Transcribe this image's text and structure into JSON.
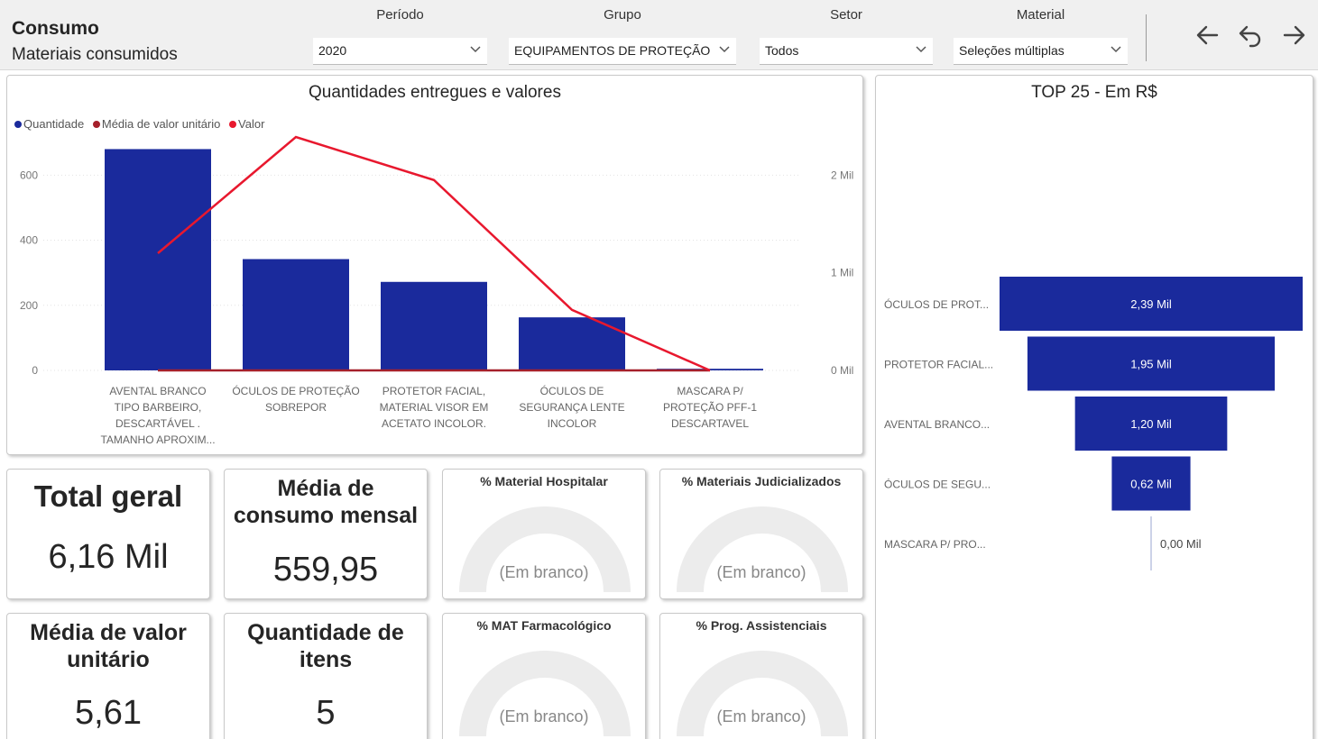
{
  "header": {
    "title": "Consumo",
    "subtitle": "Materiais consumidos"
  },
  "filters": [
    {
      "label": "Período",
      "value": "2020"
    },
    {
      "label": "Grupo",
      "value": "EQUIPAMENTOS DE PROTEÇÃO"
    },
    {
      "label": "Setor",
      "value": "Todos"
    },
    {
      "label": "Material",
      "value": "Seleções múltiplas"
    }
  ],
  "nav": {
    "back_icon": "arrow-left-icon",
    "undo_icon": "undo-icon",
    "forward_icon": "arrow-right-icon"
  },
  "colors": {
    "bar": "#1a2a9c",
    "valor_line": "#e8182e",
    "media_line": "#a5202b",
    "gauge": "#ececec"
  },
  "chart_data": [
    {
      "type": "bar",
      "title": "Quantidades entregues e valores",
      "legend": [
        "Quantidade",
        "Média de valor unitário",
        "Valor"
      ],
      "categories": [
        [
          "AVENTAL BRANCO",
          "TIPO BARBEIRO,",
          "DESCARTÁVEL .",
          "TAMANHO APROXIM..."
        ],
        [
          "ÓCULOS DE PROTEÇÃO",
          "SOBREPOR"
        ],
        [
          "PROTETOR FACIAL,",
          "MATERIAL VISOR EM",
          "ACETATO INCOLOR."
        ],
        [
          "ÓCULOS DE",
          "SEGURANÇA LENTE",
          "INCOLOR"
        ],
        [
          "MASCARA P/",
          "PROTEÇÃO PFF-1",
          "DESCARTAVEL"
        ]
      ],
      "series": [
        {
          "name": "Quantidade",
          "values": [
            680,
            342,
            272,
            163,
            5
          ]
        },
        {
          "name": "Média de valor unitário",
          "values": [
            0,
            0,
            0,
            0,
            0
          ]
        },
        {
          "name": "Valor",
          "values": [
            1200,
            2390,
            1950,
            620,
            0
          ]
        }
      ],
      "y_left": {
        "ylim": [
          0,
          720
        ],
        "ticks": [
          0,
          200,
          400,
          600
        ]
      },
      "y_right": {
        "ylim": [
          0,
          2400
        ],
        "ticks": [
          0,
          1000,
          2000
        ],
        "tick_labels": [
          "0 Mil",
          "1 Mil",
          "2 Mil"
        ]
      },
      "legend_position": "top-left",
      "grid": true
    },
    {
      "type": "bar",
      "title": "TOP 25 - Em R$",
      "orientation": "horizontal-funnel",
      "categories": [
        "ÓCULOS DE PROT...",
        "PROTETOR FACIAL...",
        "AVENTAL BRANCO...",
        "ÓCULOS DE SEGU...",
        "MASCARA P/ PRO..."
      ],
      "values": [
        2.39,
        1.95,
        1.2,
        0.62,
        0.0
      ],
      "value_labels": [
        "2,39 Mil",
        "1,95 Mil",
        "1,20 Mil",
        "0,62 Mil",
        "0,00 Mil"
      ]
    }
  ],
  "kpis": {
    "total": {
      "title": "Total geral",
      "value": "6,16 Mil"
    },
    "media_consumo": {
      "title_1": "Média de",
      "title_2": "consumo mensal",
      "value": "559,95"
    },
    "media_valor": {
      "title_1": "Média de valor",
      "title_2": "unitário",
      "value": "5,61"
    },
    "qtd_itens": {
      "title_1": "Quantidade de",
      "title_2": "itens",
      "value": "5"
    }
  },
  "gauges": [
    {
      "title": "% Material Hospitalar",
      "value": "(Em branco)"
    },
    {
      "title": "% Materiais Judicializados",
      "value": "(Em branco)"
    },
    {
      "title": "% MAT Farmacológico",
      "value": "(Em branco)"
    },
    {
      "title": "% Prog. Assistenciais",
      "value": "(Em branco)"
    }
  ]
}
